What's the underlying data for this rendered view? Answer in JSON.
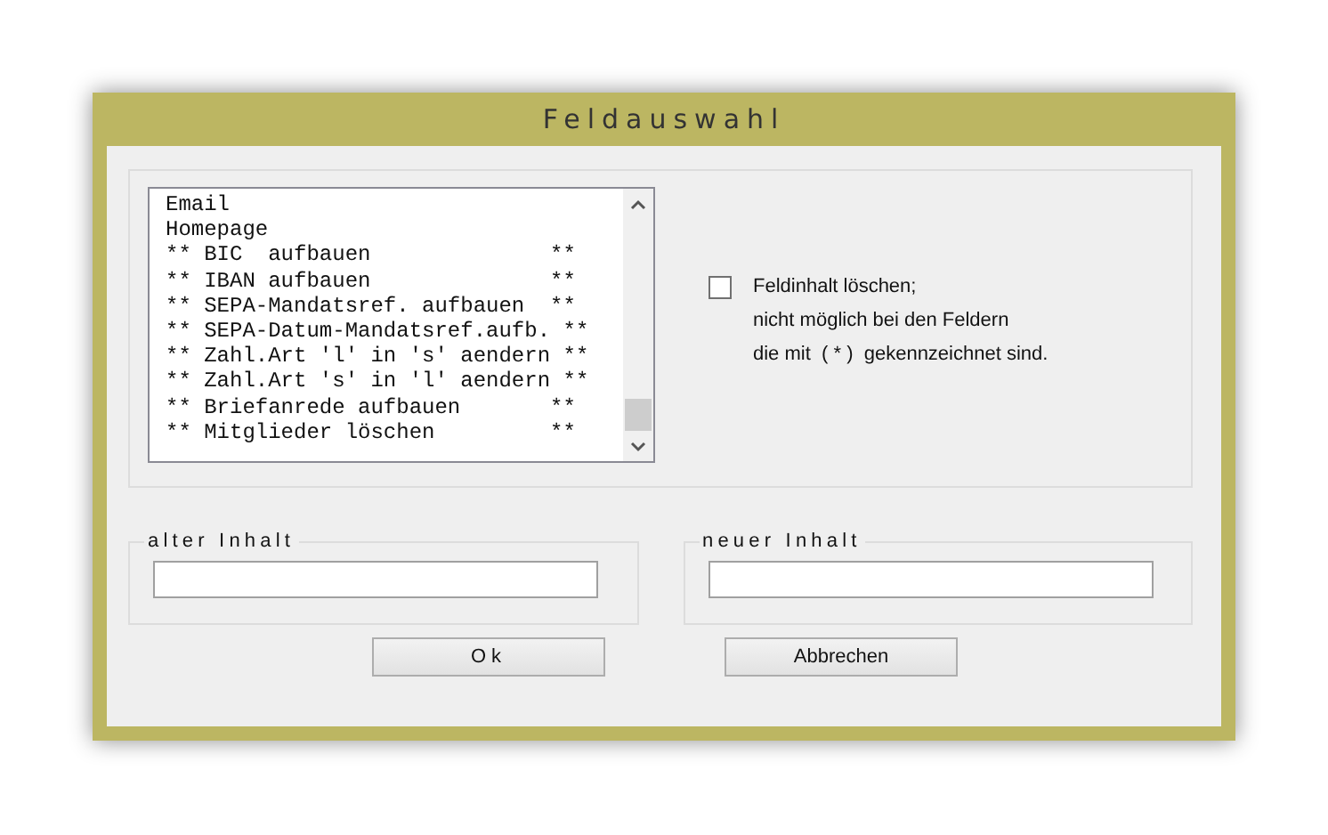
{
  "window": {
    "title": "Feldauswahl"
  },
  "field_list": {
    "items": [
      "Email",
      "Homepage",
      "** BIC  aufbauen              **",
      "** IBAN aufbauen              **",
      "** SEPA-Mandatsref. aufbauen  **",
      "** SEPA-Datum-Mandatsref.aufb. **",
      "** Zahl.Art 'l' in 's' aendern **",
      "** Zahl.Art 's' in 'l' aendern **",
      "** Briefanrede aufbauen       **",
      "** Mitglieder löschen         **"
    ]
  },
  "clear_option": {
    "checked": false,
    "label": "Feldinhalt löschen;",
    "note_lines": [
      "nicht möglich bei den Feldern",
      "die mit  ( * )  gekennzeichnet sind."
    ]
  },
  "old_content": {
    "label": "alter Inhalt"
  },
  "new_content": {
    "label": "neuer Inhalt"
  },
  "buttons": [
    "Ok",
    "Abbrechen"
  ]
}
